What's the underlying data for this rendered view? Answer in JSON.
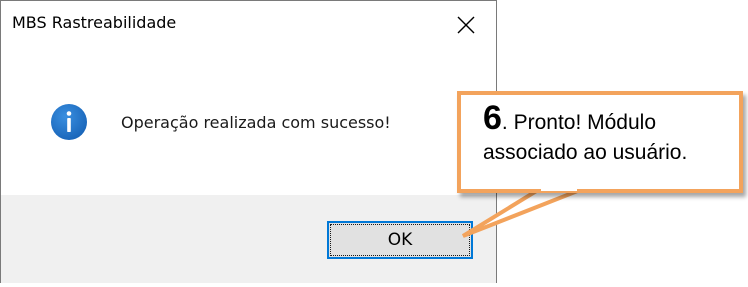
{
  "dialog": {
    "title": "MBS Rastreabilidade",
    "message": "Operação realizada com sucesso!",
    "icon": "info-icon",
    "ok_label": "OK",
    "close_icon": "close-icon"
  },
  "callout": {
    "step": "6",
    "text_line1": ". Pronto! Módulo",
    "text_line2": "associado ao usuário.",
    "border_color": "#f3a35c"
  },
  "colors": {
    "accent": "#0078d7",
    "info_icon": "#1e73c7",
    "footer_bg": "#f0f0f0"
  }
}
